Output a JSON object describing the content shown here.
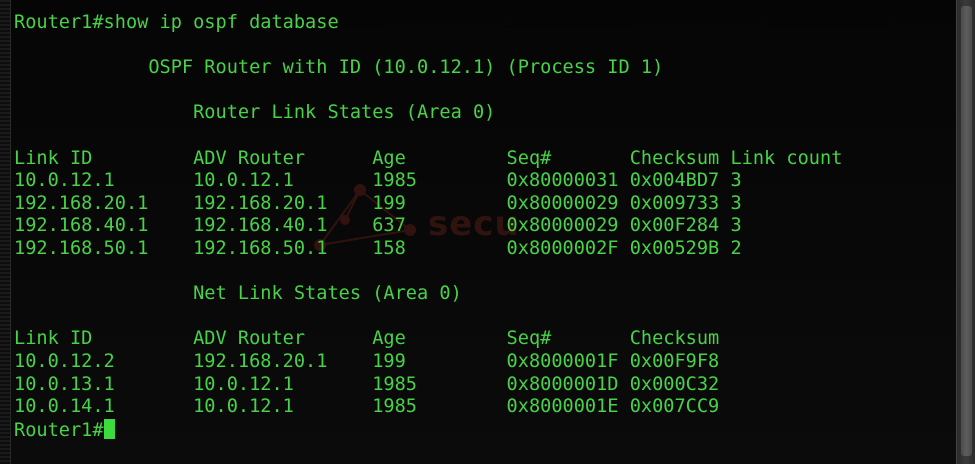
{
  "terminal": {
    "command_line": "Router1#show ip ospf database",
    "header_line": "            OSPF Router with ID (10.0.12.1) (Process ID 1)",
    "router_section_title": "                Router Link States (Area 0)",
    "router_table_header": "Link ID         ADV Router      Age         Seq#       Checksum Link count",
    "router_rows": [
      "10.0.12.1       10.0.12.1       1985        0x80000031 0x004BD7 3",
      "192.168.20.1    192.168.20.1    199         0x80000029 0x009733 3",
      "192.168.40.1    192.168.40.1    637         0x80000029 0x00F284 3",
      "192.168.50.1    192.168.50.1    158         0x8000002F 0x00529B 2"
    ],
    "net_section_title": "                Net Link States (Area 0)",
    "net_table_header": "Link ID         ADV Router      Age         Seq#       Checksum",
    "net_rows": [
      "10.0.12.2       192.168.20.1    199         0x8000001F 0x00F9F8",
      "10.0.13.1       10.0.12.1       1985        0x8000001D 0x000C32",
      "10.0.14.1       10.0.12.1       1985        0x8000001E 0x007CC9"
    ],
    "prompt": "Router1#"
  },
  "watermark": {
    "text": "secu"
  },
  "colors": {
    "text": "#47d247",
    "background": "#000000",
    "cursor": "#3ddc3d",
    "watermark": "#c0392b"
  }
}
